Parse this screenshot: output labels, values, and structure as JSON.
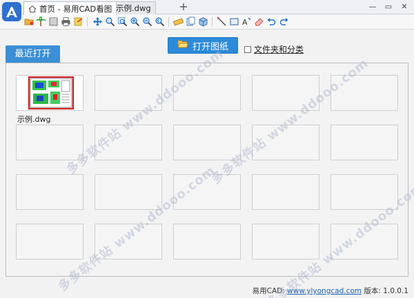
{
  "tabs": [
    {
      "label": "首页 - 易用CAD看图",
      "active": true
    },
    {
      "label": "示例.dwg",
      "active": false
    }
  ],
  "new_tab_label": "+",
  "window_buttons": {
    "minimize": "—",
    "restore": "▭",
    "close": "✕"
  },
  "toolbar_icons": [
    "open-file-icon",
    "palm-icon",
    "layers-icon",
    "print-icon",
    "export-icon",
    "pan-icon",
    "zoom-window-icon",
    "zoom-extents-icon",
    "zoom-in-icon",
    "zoom-out-icon",
    "zoom-previous-icon",
    "measure-icon",
    "layer-manager-icon",
    "3d-box-icon",
    "line-icon",
    "rectangle-icon",
    "text-icon",
    "eraser-icon",
    "undo-icon",
    "redo-icon"
  ],
  "recent_tab_label": "最近打开",
  "open_button_label": "打开图纸",
  "folder_category_label": "文件夹和分类",
  "folder_category_checked": false,
  "recent_files": [
    {
      "name": "示例.dwg",
      "has_preview": true
    }
  ],
  "grid": {
    "rows": 4,
    "cols": 5
  },
  "footer": {
    "prefix": "易用CAD: ",
    "link": "www.ylyongcad.com",
    "version_label": " 版本: ",
    "version": "1.0.0.1"
  },
  "watermark": "多多软件站  www.ddooo.com",
  "colors": {
    "accent": "#2d8ad8",
    "tab_accent": "#3b8fd6",
    "preview_border": "#d21b1b"
  }
}
